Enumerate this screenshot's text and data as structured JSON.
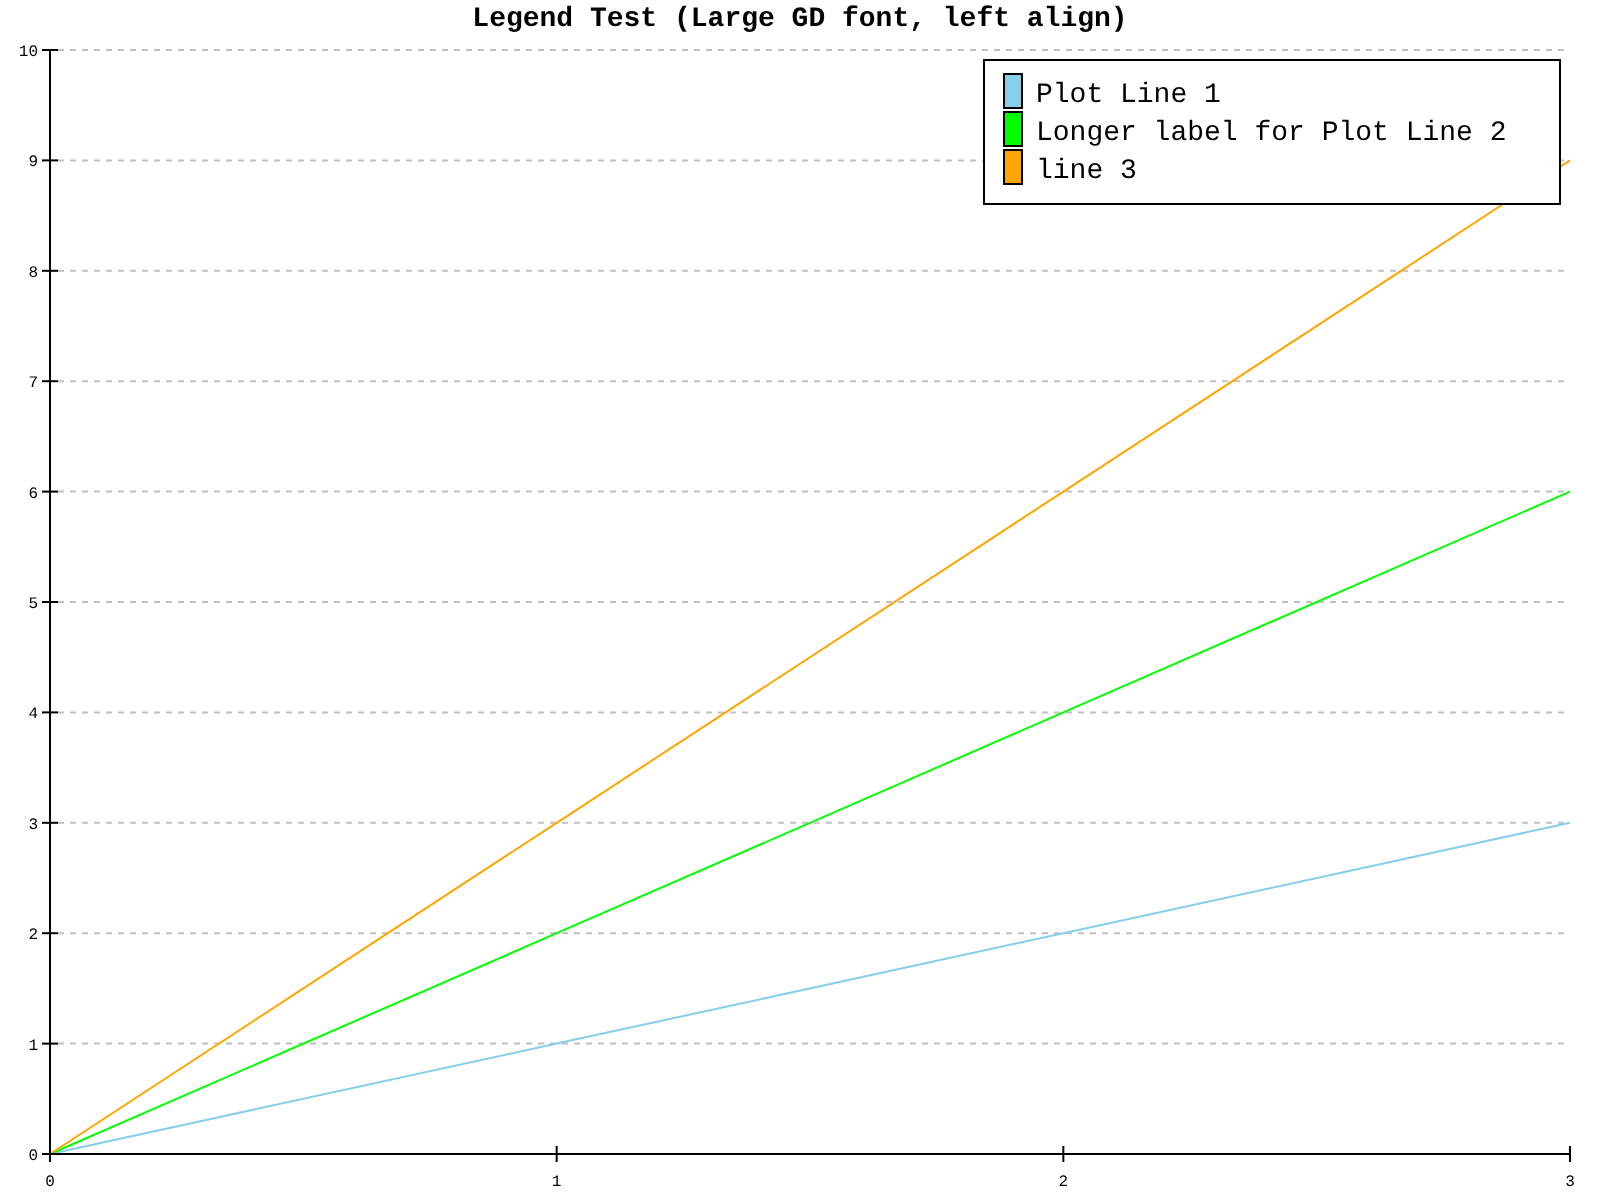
{
  "chart_data": {
    "type": "line",
    "title": "Legend Test (Large GD font, left align)",
    "x": [
      0,
      1,
      2,
      3
    ],
    "grid": true,
    "legend": true,
    "xlim": [
      0,
      3
    ],
    "ylim": [
      0,
      10
    ],
    "xticks": [
      0,
      1,
      2,
      3
    ],
    "yticks": [
      0,
      1,
      2,
      3,
      4,
      5,
      6,
      7,
      8,
      9,
      10
    ],
    "series": [
      {
        "name": "Plot Line 1",
        "color": "#87ceeb",
        "values": [
          0,
          1,
          2,
          3
        ]
      },
      {
        "name": "Longer label for Plot Line 2",
        "color": "#00ff00",
        "values": [
          0,
          2,
          4,
          6
        ]
      },
      {
        "name": "line 3",
        "color": "#ffa500",
        "values": [
          0,
          3,
          6,
          9
        ]
      }
    ]
  }
}
